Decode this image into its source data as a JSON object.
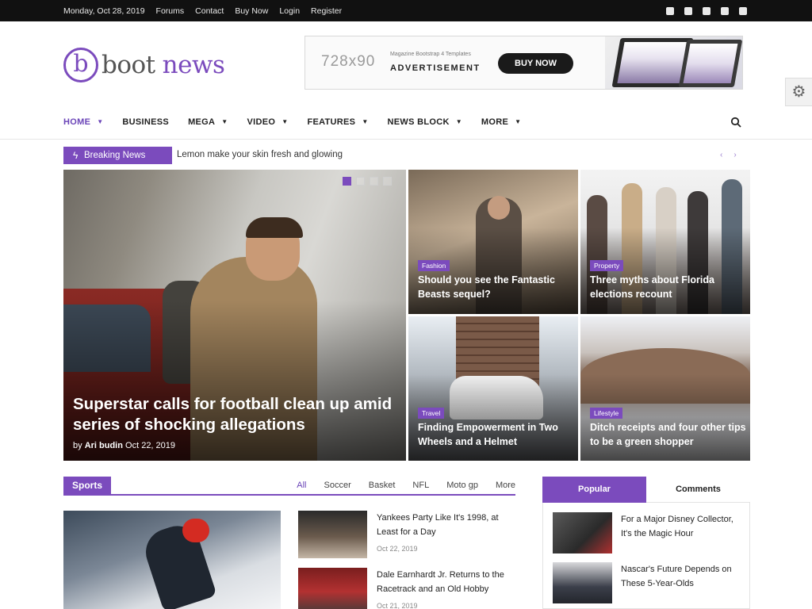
{
  "topbar": {
    "date": "Monday, Oct 28, 2019",
    "links": [
      "Forums",
      "Contact",
      "Buy Now",
      "Login",
      "Register"
    ],
    "social_icons": [
      "facebook-icon",
      "twitter-icon",
      "youtube-icon",
      "instagram-icon",
      "vimeo-icon"
    ]
  },
  "logo": {
    "mark": "b",
    "word1": "boot",
    "word2": "news"
  },
  "ad": {
    "size": "728x90",
    "subtitle": "Magazine Bootstrap 4 Templates",
    "label": "ADVERTISEMENT",
    "button": "BUY NOW"
  },
  "nav": {
    "items": [
      {
        "label": "HOME"
      },
      {
        "label": "BUSINESS"
      },
      {
        "label": "MEGA"
      },
      {
        "label": "VIDEO"
      },
      {
        "label": "FEATURES"
      },
      {
        "label": "NEWS BLOCK"
      },
      {
        "label": "MORE"
      }
    ],
    "active": "HOME"
  },
  "breaking": {
    "label": "Breaking News",
    "headline": "Lemon make your skin fresh and glowing",
    "arrows": [
      "‹",
      "›"
    ]
  },
  "hero": {
    "title": "Superstar calls for football clean up amid series of shocking allegations",
    "by_prefix": "by",
    "author": "Ari budin",
    "date": "Oct 22, 2019"
  },
  "tiles": [
    {
      "category": "Fashion",
      "title": "Should you see the Fantastic Beasts sequel?"
    },
    {
      "category": "Property",
      "title": "Three myths about Florida elections recount"
    },
    {
      "category": "Travel",
      "title": "Finding Empowerment in Two Wheels and a Helmet"
    },
    {
      "category": "Lifestyle",
      "title": "Ditch receipts and four other tips to be a green shopper"
    }
  ],
  "sports": {
    "label": "Sports",
    "tabs": [
      "All",
      "Soccer",
      "Basket",
      "NFL",
      "Moto gp",
      "More"
    ],
    "active_tab": "All",
    "items": [
      {
        "title": "Yankees Party Like It's 1998, at Least for a Day",
        "date": "Oct 22, 2019"
      },
      {
        "title": "Dale Earnhardt Jr. Returns to the Racetrack and an Old Hobby",
        "date": "Oct 21, 2019"
      }
    ]
  },
  "sidebar": {
    "tabs": [
      "Popular",
      "Comments"
    ],
    "active_tab": "Popular",
    "items": [
      {
        "title": "For a Major Disney Collector, It's the Magic Hour"
      },
      {
        "title": "Nascar's Future Depends on These 5-Year-Olds"
      }
    ]
  },
  "colors": {
    "accent": "#7b4bbd",
    "topbar": "#111111"
  }
}
